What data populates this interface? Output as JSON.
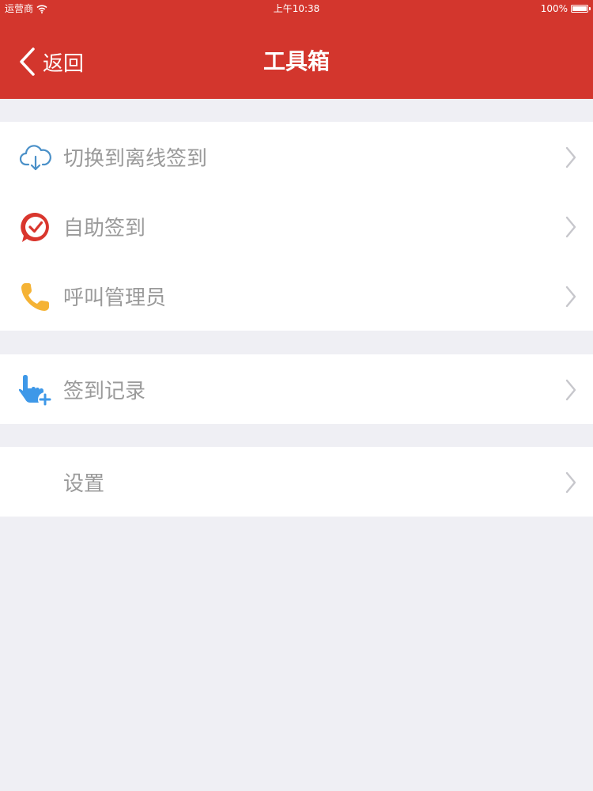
{
  "status_bar": {
    "carrier": "运营商",
    "time": "上午10:38",
    "battery": "100%"
  },
  "nav": {
    "back_label": "返回",
    "title": "工具箱"
  },
  "groups": [
    {
      "items": [
        {
          "label": "切换到离线签到",
          "icon": "cloud-download-icon"
        },
        {
          "label": "自助签到",
          "icon": "check-badge-icon"
        },
        {
          "label": "呼叫管理员",
          "icon": "phone-icon"
        }
      ]
    },
    {
      "items": [
        {
          "label": "签到记录",
          "icon": "hand-plus-icon"
        }
      ]
    },
    {
      "items": [
        {
          "label": "设置",
          "icon": ""
        }
      ]
    }
  ],
  "colors": {
    "header": "#d3362d",
    "background": "#efeff4",
    "label": "#9a9a9a",
    "chevron": "#c7c7cc"
  }
}
